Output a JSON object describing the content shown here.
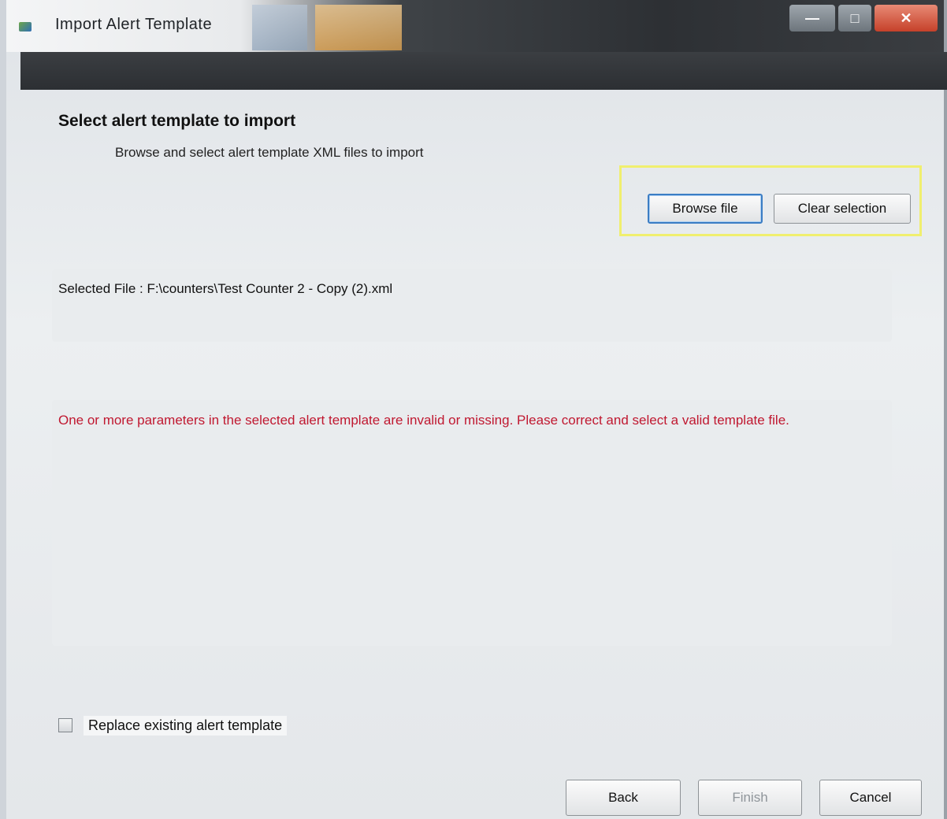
{
  "window": {
    "title": "Import Alert Template",
    "controls": {
      "minimize": "—",
      "maximize": "□",
      "close": "✕"
    }
  },
  "page": {
    "heading": "Select alert template to import",
    "subheading": "Browse and select alert template XML files to import"
  },
  "toolbar": {
    "browse_label": "Browse file",
    "clear_label": "Clear selection"
  },
  "file": {
    "selected_text": "Selected File : F:\\counters\\Test Counter 2 - Copy (2).xml"
  },
  "message": {
    "text": "One or more parameters in the selected alert template are invalid or missing. Please correct and select a valid template file."
  },
  "options": {
    "replace_label": "Replace existing alert template",
    "replace_checked": false
  },
  "footer": {
    "back_label": "Back",
    "finish_label": "Finish",
    "cancel_label": "Cancel"
  },
  "colors": {
    "error": "#c01830",
    "highlight": "#f0ef6e",
    "focus": "#3b7dc4"
  }
}
